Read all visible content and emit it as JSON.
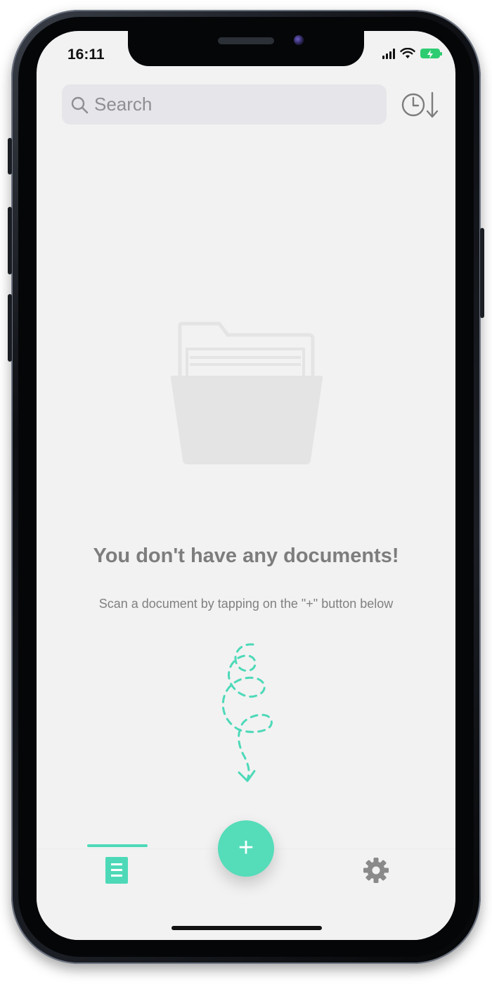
{
  "status_bar": {
    "time": "16:11"
  },
  "search": {
    "placeholder": "Search"
  },
  "empty_state": {
    "title": "You don't have any documents!",
    "subtitle": "Scan a document by tapping on the \"+\" button below"
  },
  "tabbar": {
    "add_label": "+",
    "active_tab": "documents"
  },
  "icons": {
    "search": "search-icon",
    "sort": "clock-sort-icon",
    "folder": "folder-icon",
    "arrow": "dashed-arrow-icon",
    "documents": "document-list-icon",
    "settings": "gear-icon"
  },
  "colors": {
    "accent": "#55dcb9",
    "screen_background": "#f2f2f2",
    "text_muted": "#7d7d7d"
  }
}
